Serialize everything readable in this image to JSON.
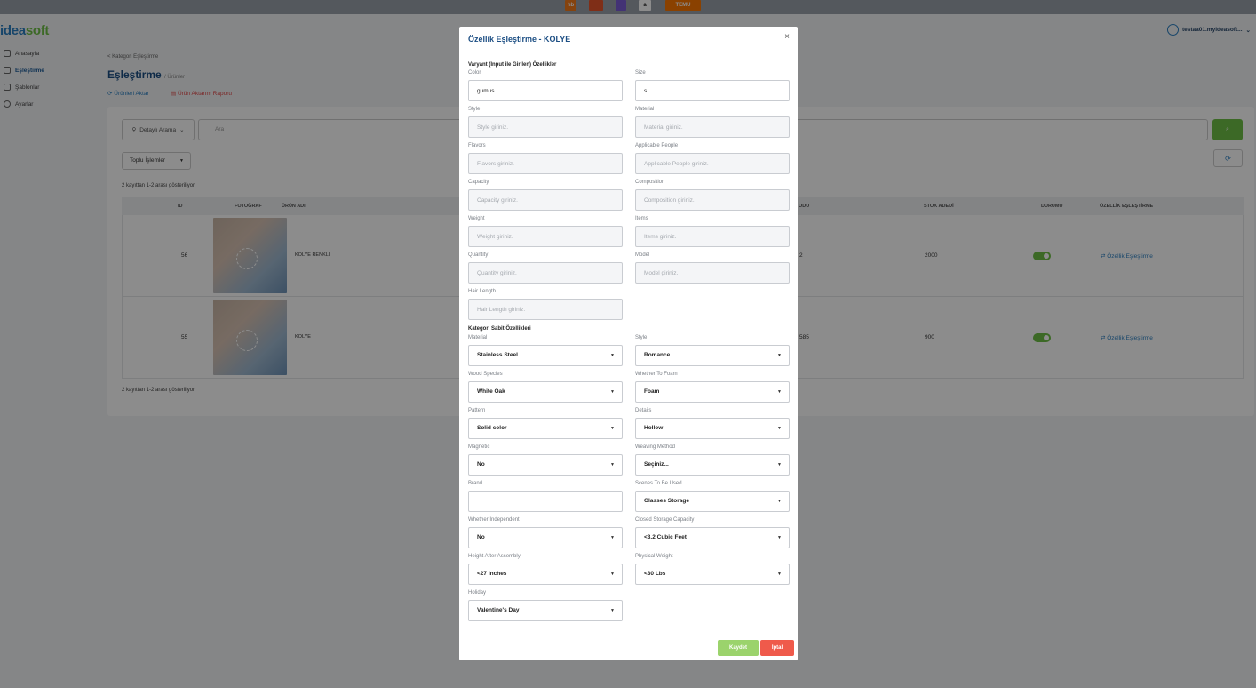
{
  "marketplaces": [
    {
      "name": "hb",
      "color": "#f27a1a"
    },
    {
      "name": "",
      "color": "#e8542a"
    },
    {
      "name": "",
      "color": "#7b5cd6"
    },
    {
      "name": "a",
      "color": "#ffffff"
    },
    {
      "name": "TEMU",
      "color": "#fb7701"
    }
  ],
  "logo": {
    "part1": "idea",
    "part2": "soft"
  },
  "sidebar": {
    "items": [
      {
        "label": "Anasayfa",
        "icon": "home-icon"
      },
      {
        "label": "Eşleştirme",
        "icon": "link-icon"
      },
      {
        "label": "Şablonlar",
        "icon": "template-icon"
      },
      {
        "label": "Ayarlar",
        "icon": "gear-icon"
      }
    ]
  },
  "user": {
    "name": "testaa01.myideasoft...",
    "chevron": "⌄"
  },
  "page": {
    "breadcrumb": "< Kategori Eşleştirme",
    "title": "Eşleştirme",
    "title_sub": "/ Ürünler",
    "action_transfer": "Ürünleri Aktar",
    "action_report": "Ürün Aktarım Raporu",
    "filter_label": "Detaylı Arama",
    "search_placeholder": "Ara",
    "bulk_label": "Toplu İşlemler",
    "count_text": "2 kayıttan 1-2 arası gösteriliyor.",
    "count_text_bottom": "2 kayıttan 1-2 arası gösteriliyor.",
    "columns": [
      "ID",
      "FOTOĞRAF",
      "ÜRÜN ADI",
      "ODU",
      "STOK ADEDİ",
      "DURUMU",
      "ÖZELLİK EŞLEŞTİRME"
    ],
    "rows": [
      {
        "id": "56",
        "name": "KOLYE RENKLI",
        "code": "2",
        "stock": "2000",
        "action": "⇄ Özellik Eşleştirme"
      },
      {
        "id": "55",
        "name": "KOLYE",
        "code": "585",
        "stock": "900",
        "action": "⇄ Özellik Eşleştirme"
      }
    ]
  },
  "modal": {
    "title": "Özellik Eşleştirme - KOLYE",
    "close": "×",
    "variant_section": "Varyant (Input ile Girilen) Özellikler",
    "variant_fields": [
      {
        "label": "Color",
        "value": "gumus",
        "placeholder": ""
      },
      {
        "label": "Size",
        "value": "s",
        "placeholder": ""
      },
      {
        "label": "Style",
        "value": "",
        "placeholder": "Style giriniz."
      },
      {
        "label": "Material",
        "value": "",
        "placeholder": "Material giriniz."
      },
      {
        "label": "Flavors",
        "value": "",
        "placeholder": "Flavors giriniz."
      },
      {
        "label": "Applicable People",
        "value": "",
        "placeholder": "Applicable People giriniz."
      },
      {
        "label": "Capacity",
        "value": "",
        "placeholder": "Capacity giriniz."
      },
      {
        "label": "Composition",
        "value": "",
        "placeholder": "Composition giriniz."
      },
      {
        "label": "Weight",
        "value": "",
        "placeholder": "Weight giriniz."
      },
      {
        "label": "Items",
        "value": "",
        "placeholder": "Items giriniz."
      },
      {
        "label": "Quantity",
        "value": "",
        "placeholder": "Quantity giriniz."
      },
      {
        "label": "Model",
        "value": "",
        "placeholder": "Model giriniz."
      },
      {
        "label": "Hair Length",
        "value": "",
        "placeholder": "Hair Length giriniz."
      }
    ],
    "fixed_section": "Kategori Sabit Özellikleri",
    "fixed_fields": [
      {
        "label": "Material",
        "value": "Stainless Steel",
        "type": "select"
      },
      {
        "label": "Style",
        "value": "Romance",
        "type": "select"
      },
      {
        "label": "Wood Species",
        "value": "White Oak",
        "type": "select"
      },
      {
        "label": "Whether To Foam",
        "value": "Foam",
        "type": "select"
      },
      {
        "label": "Pattern",
        "value": "Solid color",
        "type": "select"
      },
      {
        "label": "Details",
        "value": "Hollow",
        "type": "select"
      },
      {
        "label": "Magnetic",
        "value": "No",
        "type": "select"
      },
      {
        "label": "Weaving Method",
        "value": "Seçiniz...",
        "type": "select"
      },
      {
        "label": "Brand",
        "value": "",
        "type": "input"
      },
      {
        "label": "Scenes To Be Used",
        "value": "Glasses Storage",
        "type": "select"
      },
      {
        "label": "Whether Independent",
        "value": "No",
        "type": "select"
      },
      {
        "label": "Closed Storage Capacity",
        "value": "<3.2 Cubic Feet",
        "type": "select"
      },
      {
        "label": "Height After Assembly",
        "value": "<27 Inches",
        "type": "select"
      },
      {
        "label": "Physical Weight",
        "value": "<30 Lbs",
        "type": "select"
      },
      {
        "label": "Holiday",
        "value": "Valentine's Day",
        "type": "select"
      }
    ],
    "save_label": "Kaydet",
    "cancel_label": "İptal"
  }
}
